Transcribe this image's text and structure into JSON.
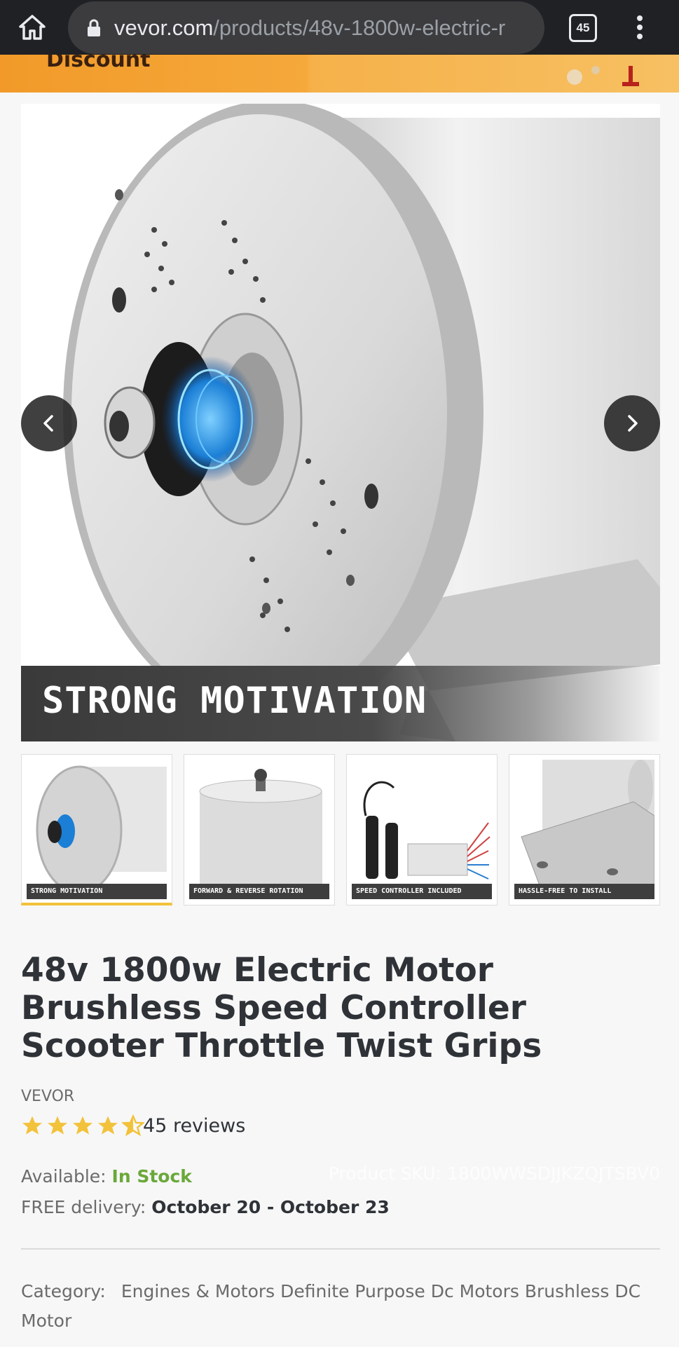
{
  "browser": {
    "url_domain": "vevor.com",
    "url_path": "/products/48v-1800w-electric-r",
    "tab_count": "45"
  },
  "promo": {
    "text": "Discount"
  },
  "gallery": {
    "main_caption": "STRONG MOTIVATION",
    "thumbnails": [
      {
        "label": "STRONG MOTIVATION"
      },
      {
        "label": "FORWARD & REVERSE ROTATION"
      },
      {
        "label": "SPEED CONTROLLER INCLUDED"
      },
      {
        "label": "HASSLE-FREE TO INSTALL"
      }
    ],
    "active_index": 0
  },
  "product": {
    "title": "48v 1800w Electric Motor Brushless Speed Controller Scooter Throttle Twist Grips",
    "brand": "VEVOR",
    "rating": 4.5,
    "rating_max": 5,
    "reviews": "45 reviews",
    "available_label": "Available:",
    "stock_status": "In Stock",
    "sku": "Product SKU: 1800WWSDJJKZQJTSBV0",
    "delivery_label": "FREE delivery:",
    "delivery_dates": "October 20 - October 23",
    "category_label": "Category:",
    "category_value": "Engines & Motors Definite Purpose Dc Motors Brushless DC Motor"
  },
  "colors": {
    "accent_star": "#f2c23a",
    "stock_green": "#6aa83a",
    "active_underline": "#f2c23a"
  }
}
